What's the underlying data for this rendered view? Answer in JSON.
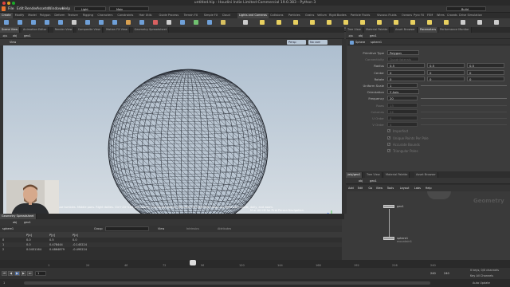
{
  "window": {
    "title": "untitled.hip - Houdini Indie Limited-Commercial 19.0.383 - Python 3"
  },
  "menubar": {
    "items": [
      "File",
      "Edit",
      "Render",
      "Assets",
      "Windows",
      "Help"
    ],
    "shelf_set": "Light",
    "desktop": "Main",
    "build": "Build"
  },
  "shelf_tabs_left": [
    "Create",
    "Modify",
    "Model",
    "Polygon",
    "Deform",
    "Texture",
    "Rigging",
    "Characters",
    "Constraints",
    "Hair Utils",
    "Guide Process",
    "Terrain FX",
    "Simple FX",
    "Cloud FX",
    "Volume"
  ],
  "shelf_tabs_right": [
    "Lights and Cameras",
    "Collisions",
    "Particles",
    "Grains",
    "Vellum",
    "Rigid Bodies",
    "Particle Fluids",
    "Viscous Fluids",
    "Oceans",
    "Pyro FX",
    "FEM",
    "Wires",
    "Crowds",
    "Drive Simulation"
  ],
  "tools_left": [
    {
      "label": "Box",
      "color": "#6fa0d8"
    },
    {
      "label": "Sphere",
      "color": "#6fa0d8"
    },
    {
      "label": "Tube",
      "color": "#6fa0d8"
    },
    {
      "label": "Torus",
      "color": "#6fa0d8"
    },
    {
      "label": "Grid",
      "color": "#6fa0d8"
    },
    {
      "label": "Null",
      "color": "#cccccc"
    },
    {
      "label": "Line",
      "color": "#6fa0d8"
    },
    {
      "label": "Circle",
      "color": "#6fa0d8"
    },
    {
      "label": "Curve Bezier",
      "color": "#6fa0d8"
    },
    {
      "label": "Draw Curve",
      "color": "#d8a050"
    },
    {
      "label": "Path",
      "color": "#6fa0d8"
    },
    {
      "label": "Spray Paint",
      "color": "#d86060"
    },
    {
      "label": "Font",
      "color": "#cccccc"
    },
    {
      "label": "Platonic Solids",
      "color": "#6fa0d8"
    },
    {
      "label": "L-System",
      "color": "#70c070"
    },
    {
      "label": "Metaball",
      "color": "#6fa0d8"
    },
    {
      "label": "File",
      "color": "#d8c060"
    }
  ],
  "tools_right": [
    {
      "label": "Camera",
      "color": "#cccccc"
    },
    {
      "label": "Point Light",
      "color": "#e8d060"
    },
    {
      "label": "Spot Light",
      "color": "#e8d060"
    },
    {
      "label": "Area Light",
      "color": "#e8d060"
    },
    {
      "label": "Geometry Light",
      "color": "#e8d060"
    },
    {
      "label": "Volume Light",
      "color": "#e8d060"
    },
    {
      "label": "Distant Light",
      "color": "#e8d060"
    },
    {
      "label": "Environment Light",
      "color": "#e8d060"
    },
    {
      "label": "Sky Light",
      "color": "#e8d060"
    },
    {
      "label": "GI Light",
      "color": "#e8d060"
    },
    {
      "label": "Caustic Light",
      "color": "#e8d060"
    },
    {
      "label": "Portal Light",
      "color": "#e8d060"
    },
    {
      "label": "Ambient Light",
      "color": "#e8d060"
    },
    {
      "label": "Stereo Camera",
      "color": "#cccccc"
    },
    {
      "label": "VR Camera",
      "color": "#cccccc"
    },
    {
      "label": "Switcher",
      "color": "#cccccc"
    }
  ],
  "left_pane_tabs": [
    "Scene View",
    "Animation Editor",
    "Render View",
    "Composite View",
    "Motion FX View",
    "Geometry Spreadsheet"
  ],
  "right_pane_tabs": [
    "Tree View",
    "Material Palette",
    "Asset Browser",
    "Parameters",
    "Performance Monitor"
  ],
  "path": {
    "obj": "obj",
    "geo": "geo1"
  },
  "viewport": {
    "label": "View",
    "persp": "Persp",
    "cam": "No cam",
    "status_text": "Left mouse tumbles. Middle pans. Right dollies. Ctrl+Alt+Left box-zooms. Ctrl+Right zooms. Spacebar-Ctrl-Left tilts. Hold L for alternate tumble, dolly, and zoom.",
    "hint": "M or Alt+M for First Person Navigation."
  },
  "params": {
    "node_type": "Sphere",
    "node_name": "sphere1",
    "rows": [
      {
        "label": "Primitive Type",
        "value": "Polygon",
        "kind": "menu",
        "dim": false
      },
      {
        "label": "Connectivity",
        "value": "Quadrilaterals",
        "kind": "menu",
        "dim": true
      },
      {
        "label": "Radius",
        "values": [
          "0.5",
          "0.5",
          "0.5"
        ],
        "kind": "vec",
        "dim": false
      },
      {
        "label": "Center",
        "values": [
          "0",
          "0",
          "0"
        ],
        "kind": "vec",
        "dim": false
      },
      {
        "label": "Rotate",
        "values": [
          "0",
          "0",
          "0"
        ],
        "kind": "vec",
        "dim": false
      },
      {
        "label": "Uniform Scale",
        "values": [
          "1"
        ],
        "kind": "slider",
        "dim": false
      },
      {
        "label": "Orientation",
        "value": "Y Axis",
        "kind": "menu",
        "dim": false
      },
      {
        "label": "Frequency",
        "values": [
          "20"
        ],
        "kind": "slider",
        "dim": false
      },
      {
        "label": "Rows",
        "values": [
          "13"
        ],
        "kind": "slider",
        "dim": true
      },
      {
        "label": "Columns",
        "values": [
          "24"
        ],
        "kind": "slider",
        "dim": true
      },
      {
        "label": "U Order",
        "values": [
          "4"
        ],
        "kind": "slider",
        "dim": true
      },
      {
        "label": "V Order",
        "values": [
          "4"
        ],
        "kind": "slider",
        "dim": true
      },
      {
        "label": "Imperfect",
        "kind": "check",
        "dim": true
      },
      {
        "label": "Unique Points Per Pole",
        "kind": "check",
        "dim": true
      },
      {
        "label": "Accurate Bounds",
        "kind": "check",
        "dim": true
      },
      {
        "label": "Triangular Poles",
        "kind": "check",
        "dim": true
      }
    ]
  },
  "network": {
    "tabs": [
      "/obj/geo1",
      "Tree View",
      "Material Palette",
      "Asset Browser"
    ],
    "menu": [
      "Add",
      "Edit",
      "Go",
      "View",
      "Tools",
      "Layout",
      "Labs",
      "Help"
    ],
    "context_label": "Geometry",
    "nodes": [
      {
        "name": "sphere1",
        "flag": "Sphere"
      },
      {
        "name": "geo1",
        "flag": ""
      }
    ],
    "node_label_bottom": "mountain1"
  },
  "spreadsheet": {
    "tab": "Geometry Spreadsheet",
    "node": "sphere1",
    "group_label": "Group",
    "view_label": "View",
    "intrinsics": "Intrinsics",
    "attributes": "Attributes",
    "columns": [
      "P[x]",
      "P[y]",
      "P[z]"
    ],
    "rows": [
      {
        "index": "0",
        "x": "0.0",
        "y": "0.5",
        "z": "0.0"
      },
      {
        "index": "1",
        "x": "0.0",
        "y": "0.478444",
        "z": "-0.145224"
      },
      {
        "index": "2",
        "x": "0.0451164",
        "y": "0.4864879",
        "z": "-0.495224"
      }
    ]
  },
  "timeline": {
    "frame": "1",
    "start": "1",
    "end": "240",
    "end2": "240",
    "auto_update": "Auto Update",
    "keys": "0 keys, 0/0 channels",
    "all_channels": "Key All Channels",
    "ticks": [
      "1",
      "24",
      "48",
      "72",
      "96",
      "120",
      "144",
      "168",
      "192",
      "216",
      "240"
    ]
  }
}
